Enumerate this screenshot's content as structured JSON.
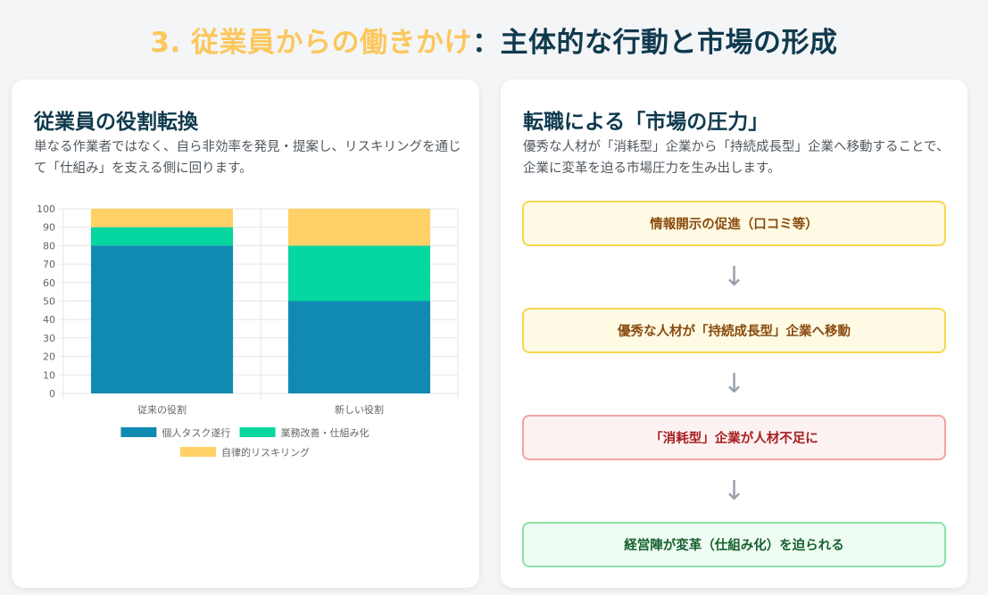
{
  "title": {
    "prefix": "3. 従業員からの働きかけ",
    "suffix": "：主体的な行動と市場の形成"
  },
  "left_card": {
    "heading": "従業員の役割転換",
    "description": "単なる作業者ではなく、自ら非効率を発見・提案し、リスキリングを通じて「仕組み」を支える側に回ります。"
  },
  "right_card": {
    "heading": "転職による「市場の圧力」",
    "description": "優秀な人材が「消耗型」企業から「持続成長型」企業へ移動することで、企業に変革を迫る市場圧力を生み出します。",
    "flow": [
      {
        "label": "情報開示の促進（口コミ等）",
        "style": "yellow"
      },
      {
        "label": "優秀な人材が「持続成長型」企業へ移動",
        "style": "yellow"
      },
      {
        "label": "「消耗型」企業が人材不足に",
        "style": "red"
      },
      {
        "label": "経営陣が変革（仕組み化）を迫られる",
        "style": "green"
      }
    ],
    "arrow_glyph": "↓"
  },
  "chart_data": {
    "type": "bar",
    "stacked": true,
    "categories": [
      "従来の役割",
      "新しい役割"
    ],
    "series": [
      {
        "name": "個人タスク遂行",
        "values": [
          80,
          50
        ],
        "color": "#118ab2"
      },
      {
        "name": "業務改善・仕組み化",
        "values": [
          10,
          30
        ],
        "color": "#06d6a0"
      },
      {
        "name": "自律的リスキリング",
        "values": [
          10,
          20
        ],
        "color": "#ffd166"
      }
    ],
    "ylim": [
      0,
      100
    ],
    "yticks": [
      0,
      10,
      20,
      30,
      40,
      50,
      60,
      70,
      80,
      90,
      100
    ],
    "grid": true,
    "legend_position": "bottom"
  }
}
